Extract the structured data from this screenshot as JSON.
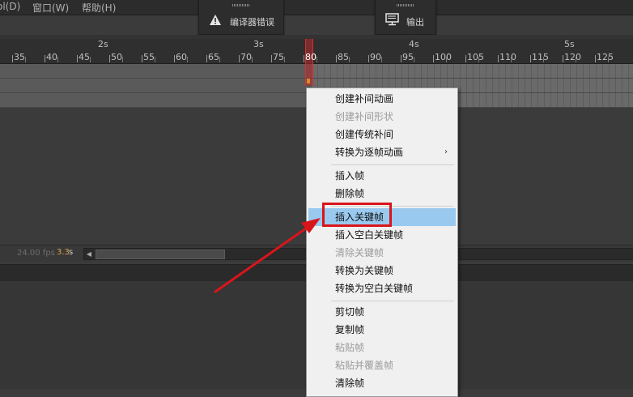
{
  "menubar": {
    "items": [
      "ol(D)",
      "窗口(W)",
      "帮助(H)"
    ]
  },
  "panels": {
    "compile_errors": "编译器错误",
    "output": "输出"
  },
  "timeline": {
    "seconds": [
      "2s",
      "3s",
      "4s",
      "5s"
    ],
    "frames": [
      "35",
      "40",
      "45",
      "50",
      "55",
      "60",
      "65",
      "70",
      "75",
      "80",
      "85",
      "90",
      "95",
      "100",
      "105",
      "110",
      "115",
      "120",
      "125"
    ],
    "playhead_frame": "80",
    "fps": "24.00 fps",
    "elapsed": "3.3",
    "elapsed_unit": "s"
  },
  "context_menu": {
    "groups": [
      [
        {
          "label": "创建补间动画",
          "enabled": true
        },
        {
          "label": "创建补间形状",
          "enabled": false
        },
        {
          "label": "创建传统补间",
          "enabled": true
        },
        {
          "label": "转换为逐帧动画",
          "enabled": true,
          "submenu": true
        }
      ],
      [
        {
          "label": "插入帧",
          "enabled": true
        },
        {
          "label": "删除帧",
          "enabled": true
        }
      ],
      [
        {
          "label": "插入关键帧",
          "enabled": true,
          "highlighted": true
        },
        {
          "label": "插入空白关键帧",
          "enabled": true
        },
        {
          "label": "清除关键帧",
          "enabled": false
        },
        {
          "label": "转换为关键帧",
          "enabled": true
        },
        {
          "label": "转换为空白关键帧",
          "enabled": true
        }
      ],
      [
        {
          "label": "剪切帧",
          "enabled": true
        },
        {
          "label": "复制帧",
          "enabled": true
        },
        {
          "label": "粘贴帧",
          "enabled": false
        },
        {
          "label": "粘贴并覆盖帧",
          "enabled": false
        },
        {
          "label": "清除帧",
          "enabled": true
        }
      ]
    ],
    "submenu_arrow": "›"
  },
  "icons": {
    "compile_errors": "warning-icon",
    "output": "monitor-icon",
    "scroll_left": "triangle-left-icon"
  },
  "colors": {
    "highlight": "#99c9ef",
    "annotation": "#d8151b",
    "playhead": "#c33333",
    "keyframe": "#e08a2a"
  }
}
